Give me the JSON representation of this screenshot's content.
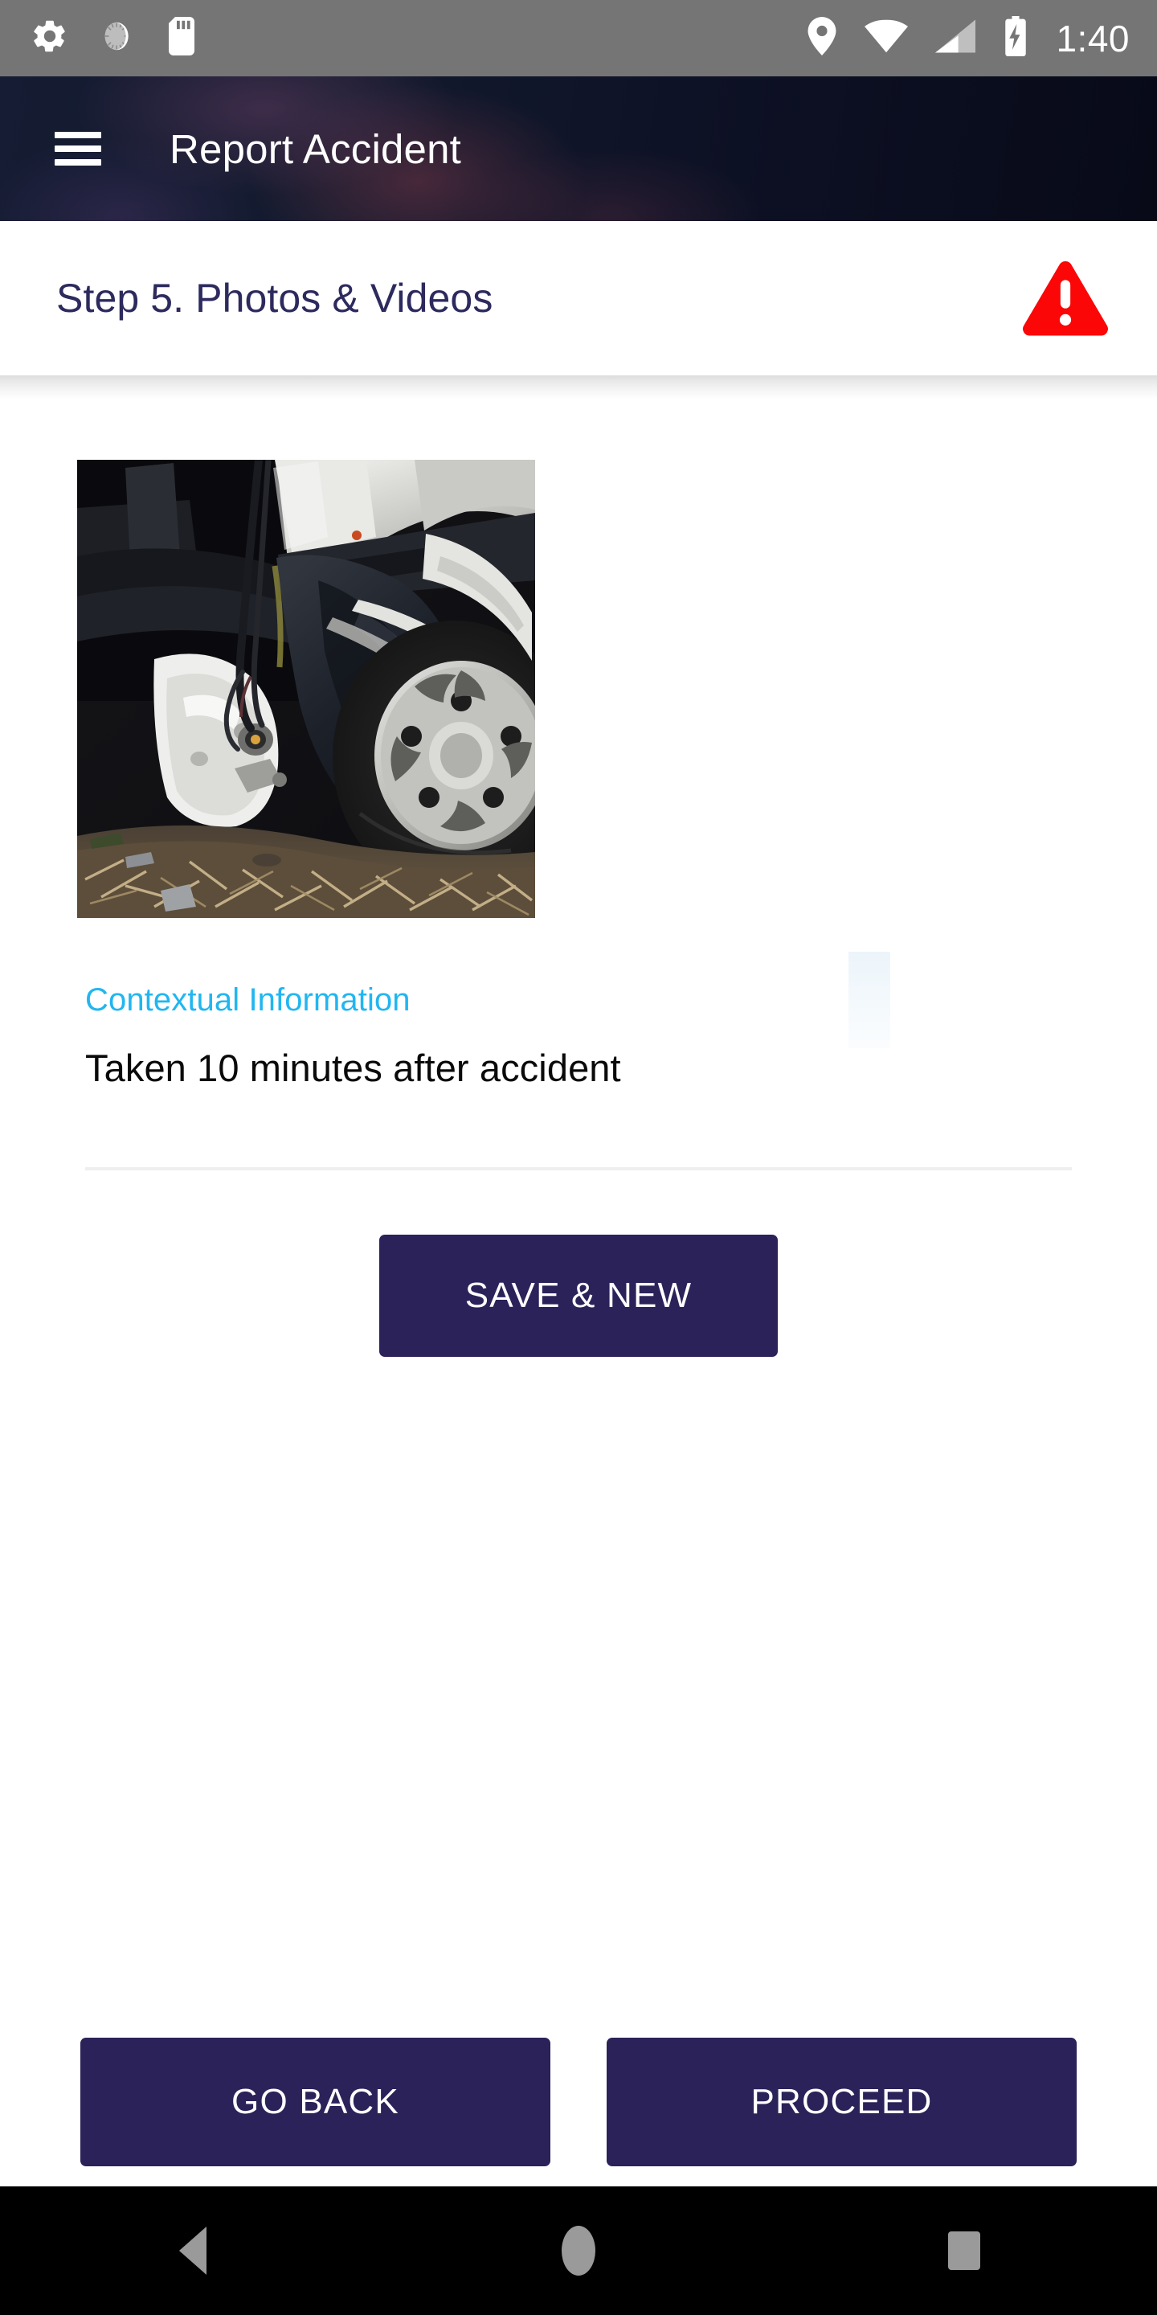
{
  "status_bar": {
    "time": "1:40",
    "left_icons": [
      "settings-gear-icon",
      "screen-rotation-icon",
      "sd-card-icon"
    ],
    "right_icons": [
      "location-pin-icon",
      "wifi-icon",
      "cellular-signal-icon",
      "battery-charging-icon"
    ],
    "background": "#757575"
  },
  "app_bar": {
    "menu_icon": "hamburger-menu-icon",
    "title": "Report Accident",
    "background": "#0e1226",
    "text_color": "#ffffff"
  },
  "step_header": {
    "title": "Step 5. Photos & Videos",
    "title_color": "#2d2a5e",
    "warning_icon": "warning-triangle-icon",
    "warning_color": "#fb0707"
  },
  "content": {
    "photo": {
      "alt": "damaged car front end photo",
      "name": "accident-photo-thumbnail"
    },
    "contextual_information": {
      "label": "Contextual Information",
      "label_color": "#21b6f0",
      "value": "Taken 10 minutes after accident",
      "placeholder": "Contextual Information",
      "value_color": "#0a0a0a"
    },
    "save_new_button": {
      "label": "SAVE & NEW",
      "background": "#2a2259",
      "text_color": "#ffffff"
    }
  },
  "bottom_bar": {
    "go_back_button": {
      "label": "GO BACK",
      "background": "#2a2259",
      "text_color": "#ffffff"
    },
    "proceed_button": {
      "label": "PROCEED",
      "background": "#2a2259",
      "text_color": "#ffffff"
    }
  },
  "nav_bar": {
    "back_icon": "nav-back-triangle-icon",
    "home_icon": "nav-home-circle-icon",
    "recents_icon": "nav-recents-square-icon",
    "background": "#000000",
    "icon_color": "#9a9a9a"
  }
}
